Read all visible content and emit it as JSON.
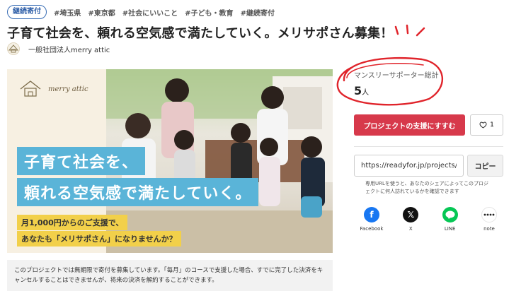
{
  "badge": "継続寄付",
  "tags": [
    "#埼玉県",
    "#東京都",
    "#社会にいいこと",
    "#子ども・教育",
    "#継続寄付"
  ],
  "title": "子育て社会を、頼れる空気感で満たしていく。メリサポさん募集！",
  "organization": {
    "name": "一般社団法人merry attic"
  },
  "hero": {
    "brand": "merry attic",
    "headline_1": "子育て社会を、",
    "headline_2": "頼れる空気感で満たしていく。",
    "sub_1": "月1,000円からのご支援で、",
    "sub_2": "あなたも「メリサポさん」になりませんか？"
  },
  "note": "このプロジェクトでは無期限で寄付を募集しています。「毎月」のコースで支援した場合、すでに完了した決済をキャンセルすることはできませんが、将来の決済を解約することができます。",
  "supporters": {
    "label": "マンスリーサポーター総計",
    "count": "5",
    "unit": "人"
  },
  "support_button": "プロジェクトの支援にすすむ",
  "like": {
    "count": "1"
  },
  "share": {
    "url": "https://readyfor.jp/projects/...",
    "copy_label": "コピー",
    "note": "専用URLを使うと、あなたのシェアによってこのプロジェクトに何人訪れているかを確認できます",
    "items": [
      {
        "label": "Facebook",
        "icon": "facebook-icon",
        "color": "#1877f2"
      },
      {
        "label": "X",
        "icon": "x-icon",
        "color": "#111111"
      },
      {
        "label": "LINE",
        "icon": "line-icon",
        "color": "#06c755"
      },
      {
        "label": "note",
        "icon": "note-icon",
        "color": "#ffffff"
      }
    ]
  },
  "colors": {
    "accent": "#d7394b",
    "badge": "#3b6fb6",
    "hero_blue": "#5ab4d8",
    "hero_yellow": "#f2d04a"
  }
}
